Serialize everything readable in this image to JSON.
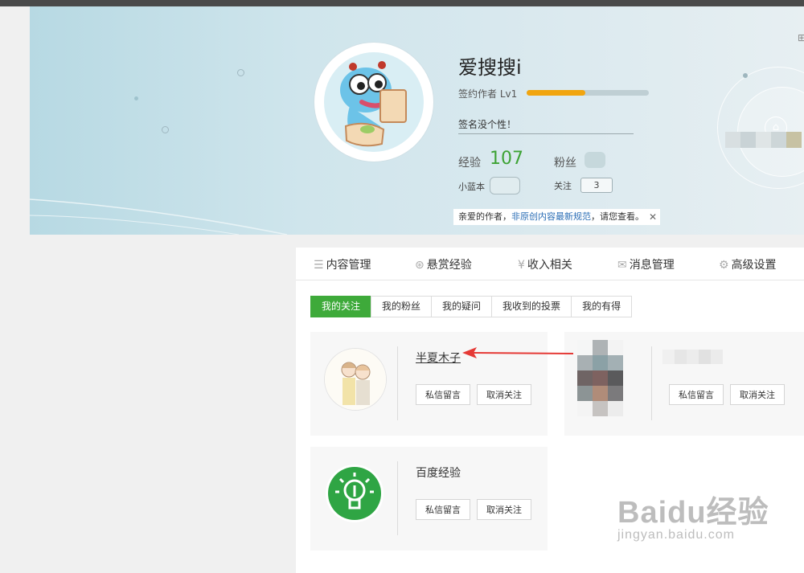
{
  "profile": {
    "username": "爱搜搜i",
    "rank_label": "签约作者 Lv1",
    "rank_progress": 0.48,
    "signature": "签名没个性！",
    "exp_label": "经验",
    "exp_value": "107",
    "fans_label": "粉丝",
    "xiaolanben_label": "小蓝本",
    "follow_label": "关注",
    "follow_value": "3",
    "notice_prefix": "亲爱的作者，",
    "notice_link": "非原创内容最新规范",
    "notice_suffix": "，请您查看。",
    "notice_close": "✕"
  },
  "nav": {
    "items": [
      {
        "label": "内容管理",
        "icon": "list-icon"
      },
      {
        "label": "悬赏经验",
        "icon": "reward-icon"
      },
      {
        "label": "收入相关",
        "icon": "yen-icon"
      },
      {
        "label": "消息管理",
        "icon": "mail-icon"
      },
      {
        "label": "高级设置",
        "icon": "gear-icon"
      }
    ]
  },
  "subtabs": [
    "我的关注",
    "我的粉丝",
    "我的疑问",
    "我收到的投票",
    "我的有得"
  ],
  "active_subtab": "我的关注",
  "follows": [
    {
      "name": "半夏木子",
      "message_btn": "私信留言",
      "unfollow_btn": "取消关注"
    },
    {
      "name": "",
      "message_btn": "私信留言",
      "unfollow_btn": "取消关注"
    },
    {
      "name": "百度经验",
      "message_btn": "私信留言",
      "unfollow_btn": "取消关注"
    }
  ],
  "watermark": {
    "brand": "Baidu经验",
    "url": "jingyan.baidu.com"
  },
  "colors": {
    "accent_green": "#3eaa3a",
    "exp_green": "#3ea335",
    "progress_orange": "#f1a50f",
    "annotation_red": "#e53935"
  }
}
